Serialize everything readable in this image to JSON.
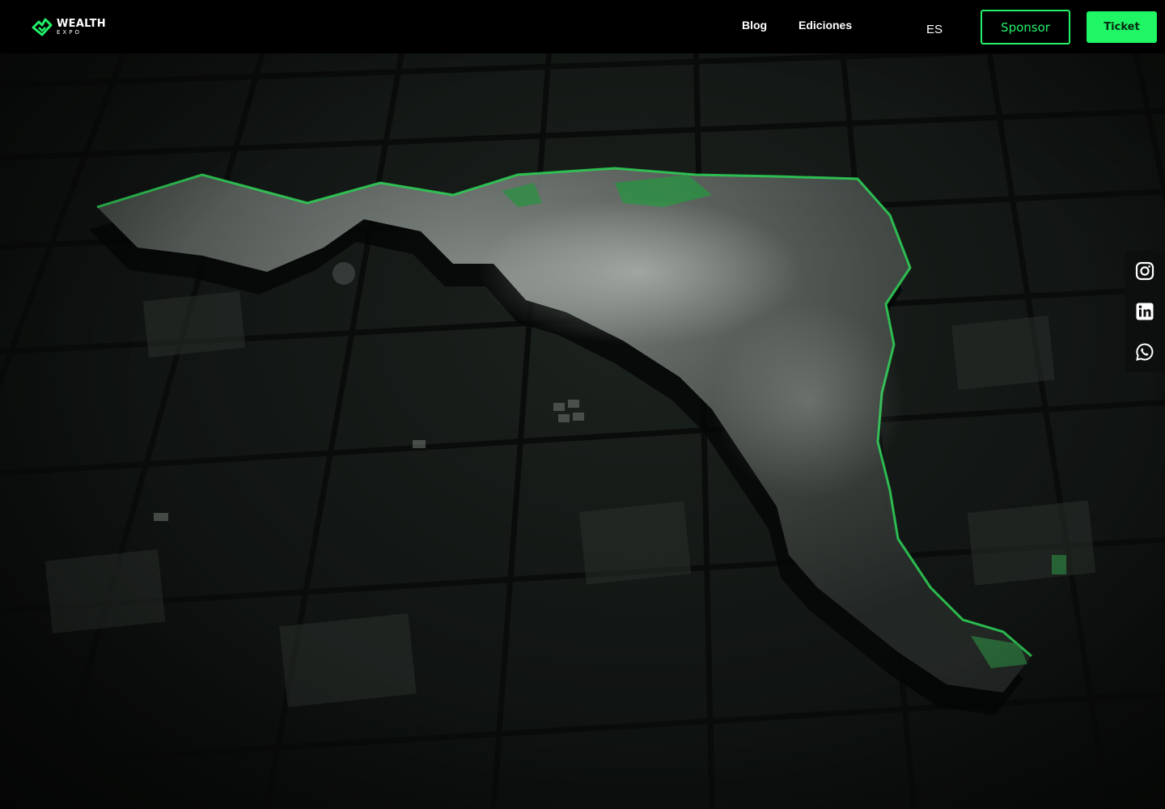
{
  "header": {
    "logo": {
      "word": "WEALTH",
      "sub": "EXPO",
      "icon": "wealth-expo-logo-mark"
    },
    "nav": [
      {
        "label": "Blog"
      },
      {
        "label": "Ediciones"
      }
    ],
    "language": "ES",
    "sponsor_label": "Sponsor",
    "ticket_label": "Ticket"
  },
  "social": [
    {
      "icon": "instagram-icon"
    },
    {
      "icon": "linkedin-icon"
    },
    {
      "icon": "whatsapp-icon"
    }
  ],
  "colors": {
    "accent": "#22f06a",
    "button_fill": "#1ff565",
    "background": "#000000",
    "map_glow": "#2ecc55"
  }
}
